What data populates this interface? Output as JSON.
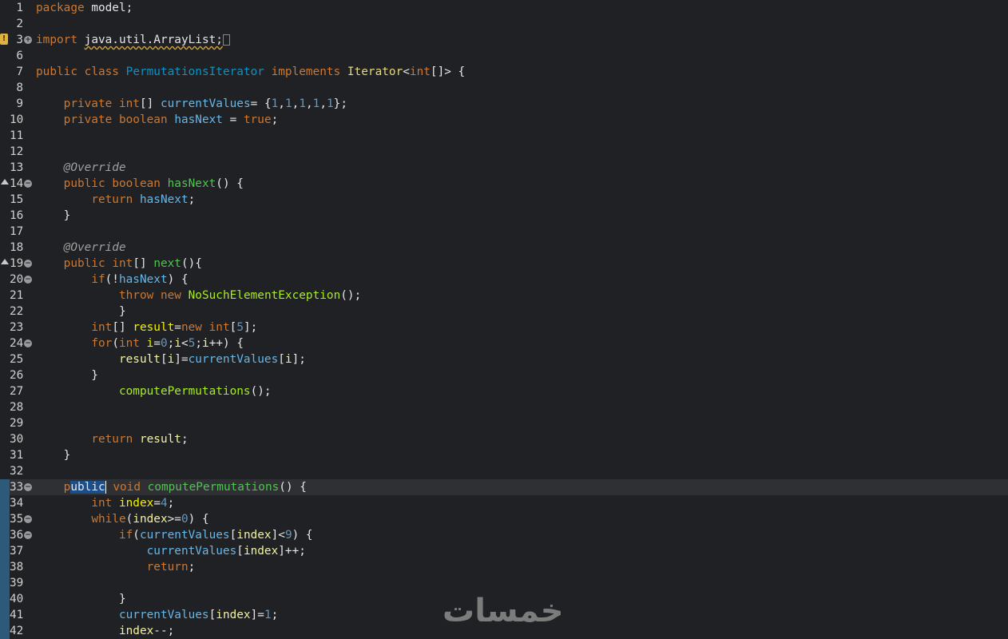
{
  "editor": {
    "language": "Java",
    "lines": [
      {
        "n": "1",
        "tokens": [
          [
            "kw",
            "package"
          ],
          [
            "plain",
            " model;"
          ]
        ]
      },
      {
        "n": "2",
        "tokens": []
      },
      {
        "n": "3",
        "fold": "+",
        "marker": "warn",
        "tokens": [
          [
            "kw",
            "import"
          ],
          [
            "plain",
            " "
          ],
          [
            "plain squig",
            "java.util.ArrayList;"
          ],
          [
            "box",
            ""
          ]
        ]
      },
      {
        "n": "6",
        "tokens": []
      },
      {
        "n": "7",
        "tokens": [
          [
            "kw",
            "public"
          ],
          [
            "plain",
            " "
          ],
          [
            "kw",
            "class"
          ],
          [
            "plain",
            " "
          ],
          [
            "cls",
            "PermutationsIterator"
          ],
          [
            "plain",
            " "
          ],
          [
            "kw",
            "implements"
          ],
          [
            "plain",
            " "
          ],
          [
            "iface",
            "Iterator"
          ],
          [
            "plain",
            "<"
          ],
          [
            "type",
            "int"
          ],
          [
            "plain",
            "[]> {"
          ]
        ]
      },
      {
        "n": "8",
        "tokens": []
      },
      {
        "n": "9",
        "tokens": [
          [
            "plain",
            "    "
          ],
          [
            "kw",
            "private"
          ],
          [
            "plain",
            " "
          ],
          [
            "type",
            "int"
          ],
          [
            "plain",
            "[] "
          ],
          [
            "fld",
            "currentValues"
          ],
          [
            "plain",
            "= {"
          ],
          [
            "num",
            "1"
          ],
          [
            "plain",
            ","
          ],
          [
            "num",
            "1"
          ],
          [
            "plain",
            ","
          ],
          [
            "num",
            "1"
          ],
          [
            "plain",
            ","
          ],
          [
            "num",
            "1"
          ],
          [
            "plain",
            ","
          ],
          [
            "num",
            "1"
          ],
          [
            "plain",
            "};"
          ]
        ]
      },
      {
        "n": "10",
        "tokens": [
          [
            "plain",
            "    "
          ],
          [
            "kw",
            "private"
          ],
          [
            "plain",
            " "
          ],
          [
            "type",
            "boolean"
          ],
          [
            "plain",
            " "
          ],
          [
            "fld",
            "hasNext"
          ],
          [
            "plain",
            " = "
          ],
          [
            "kw",
            "true"
          ],
          [
            "plain",
            ";"
          ]
        ]
      },
      {
        "n": "11",
        "tokens": []
      },
      {
        "n": "12",
        "tokens": []
      },
      {
        "n": "13",
        "tokens": [
          [
            "plain",
            "    "
          ],
          [
            "ann",
            "@Override"
          ]
        ]
      },
      {
        "n": "14",
        "fold": "-",
        "marker": "override",
        "tokens": [
          [
            "plain",
            "    "
          ],
          [
            "kw",
            "public"
          ],
          [
            "plain",
            " "
          ],
          [
            "type",
            "boolean"
          ],
          [
            "plain",
            " "
          ],
          [
            "meth",
            "hasNext"
          ],
          [
            "plain",
            "() {"
          ]
        ]
      },
      {
        "n": "15",
        "tokens": [
          [
            "plain",
            "        "
          ],
          [
            "kw",
            "return"
          ],
          [
            "plain",
            " "
          ],
          [
            "fld",
            "hasNext"
          ],
          [
            "plain",
            ";"
          ]
        ]
      },
      {
        "n": "16",
        "tokens": [
          [
            "plain",
            "    }"
          ]
        ]
      },
      {
        "n": "17",
        "tokens": []
      },
      {
        "n": "18",
        "tokens": [
          [
            "plain",
            "    "
          ],
          [
            "ann",
            "@Override"
          ]
        ]
      },
      {
        "n": "19",
        "fold": "-",
        "marker": "override",
        "tokens": [
          [
            "plain",
            "    "
          ],
          [
            "kw",
            "public"
          ],
          [
            "plain",
            " "
          ],
          [
            "type",
            "int"
          ],
          [
            "plain",
            "[] "
          ],
          [
            "meth",
            "next"
          ],
          [
            "plain",
            "(){"
          ]
        ]
      },
      {
        "n": "20",
        "fold": "-",
        "tokens": [
          [
            "plain",
            "        "
          ],
          [
            "kw",
            "if"
          ],
          [
            "plain",
            "(!"
          ],
          [
            "fld",
            "hasNext"
          ],
          [
            "plain",
            ") {"
          ]
        ]
      },
      {
        "n": "21",
        "tokens": [
          [
            "plain",
            "            "
          ],
          [
            "kw",
            "throw"
          ],
          [
            "plain",
            " "
          ],
          [
            "kw",
            "new"
          ],
          [
            "plain",
            " "
          ],
          [
            "exc",
            "NoSuchElementException"
          ],
          [
            "plain",
            "();"
          ]
        ]
      },
      {
        "n": "22",
        "tokens": [
          [
            "plain",
            "            }"
          ]
        ]
      },
      {
        "n": "23",
        "tokens": [
          [
            "plain",
            "        "
          ],
          [
            "type",
            "int"
          ],
          [
            "plain",
            "[] "
          ],
          [
            "loc",
            "result"
          ],
          [
            "plain",
            "="
          ],
          [
            "kw",
            "new"
          ],
          [
            "plain",
            " "
          ],
          [
            "type",
            "int"
          ],
          [
            "plain",
            "["
          ],
          [
            "num",
            "5"
          ],
          [
            "plain",
            "];"
          ]
        ]
      },
      {
        "n": "24",
        "fold": "-",
        "tokens": [
          [
            "plain",
            "        "
          ],
          [
            "kw",
            "for"
          ],
          [
            "plain",
            "("
          ],
          [
            "type",
            "int"
          ],
          [
            "plain",
            " "
          ],
          [
            "loc",
            "i"
          ],
          [
            "plain",
            "="
          ],
          [
            "num",
            "0"
          ],
          [
            "plain",
            ";"
          ],
          [
            "locv",
            "i"
          ],
          [
            "plain",
            "<"
          ],
          [
            "num",
            "5"
          ],
          [
            "plain",
            ";"
          ],
          [
            "locv",
            "i"
          ],
          [
            "plain",
            "++) {"
          ]
        ]
      },
      {
        "n": "25",
        "tokens": [
          [
            "plain",
            "            "
          ],
          [
            "locv",
            "result"
          ],
          [
            "plain",
            "["
          ],
          [
            "locv",
            "i"
          ],
          [
            "plain",
            "]="
          ],
          [
            "fld",
            "currentValues"
          ],
          [
            "plain",
            "["
          ],
          [
            "locv",
            "i"
          ],
          [
            "plain",
            "];"
          ]
        ]
      },
      {
        "n": "26",
        "tokens": [
          [
            "plain",
            "        }"
          ]
        ]
      },
      {
        "n": "27",
        "tokens": [
          [
            "plain",
            "            "
          ],
          [
            "mcall",
            "computePermutations"
          ],
          [
            "plain",
            "();"
          ]
        ]
      },
      {
        "n": "28",
        "tokens": []
      },
      {
        "n": "29",
        "tokens": []
      },
      {
        "n": "30",
        "tokens": [
          [
            "plain",
            "        "
          ],
          [
            "kw",
            "return"
          ],
          [
            "plain",
            " "
          ],
          [
            "locv",
            "result"
          ],
          [
            "plain",
            ";"
          ]
        ]
      },
      {
        "n": "31",
        "tokens": [
          [
            "plain",
            "    }"
          ]
        ]
      },
      {
        "n": "32",
        "tokens": []
      },
      {
        "n": "33",
        "fold": "-",
        "current": true,
        "occ": true,
        "tokens": [
          [
            "plain",
            "    "
          ],
          [
            "kw",
            "p"
          ],
          [
            "sel",
            "ublic"
          ],
          [
            "caret",
            ""
          ],
          [
            "plain",
            " "
          ],
          [
            "type",
            "void"
          ],
          [
            "plain",
            " "
          ],
          [
            "meth",
            "computePermutations"
          ],
          [
            "plain",
            "() {"
          ]
        ]
      },
      {
        "n": "34",
        "occ": true,
        "tokens": [
          [
            "plain",
            "        "
          ],
          [
            "type",
            "int"
          ],
          [
            "plain",
            " "
          ],
          [
            "loc",
            "index"
          ],
          [
            "plain",
            "="
          ],
          [
            "num",
            "4"
          ],
          [
            "plain",
            ";"
          ]
        ]
      },
      {
        "n": "35",
        "fold": "-",
        "occ": true,
        "tokens": [
          [
            "plain",
            "        "
          ],
          [
            "kw",
            "while"
          ],
          [
            "plain",
            "("
          ],
          [
            "locv",
            "index"
          ],
          [
            "plain",
            ">="
          ],
          [
            "num",
            "0"
          ],
          [
            "plain",
            ") {"
          ]
        ]
      },
      {
        "n": "36",
        "fold": "-",
        "occ": true,
        "tokens": [
          [
            "plain",
            "            "
          ],
          [
            "kw",
            "if"
          ],
          [
            "plain",
            "("
          ],
          [
            "fld",
            "currentValues"
          ],
          [
            "plain",
            "["
          ],
          [
            "locv",
            "index"
          ],
          [
            "plain",
            "]<"
          ],
          [
            "num",
            "9"
          ],
          [
            "plain",
            ") {"
          ]
        ]
      },
      {
        "n": "37",
        "occ": true,
        "tokens": [
          [
            "plain",
            "                "
          ],
          [
            "fld",
            "currentValues"
          ],
          [
            "plain",
            "["
          ],
          [
            "locv",
            "index"
          ],
          [
            "plain",
            "]++;"
          ]
        ]
      },
      {
        "n": "38",
        "occ": true,
        "tokens": [
          [
            "plain",
            "                "
          ],
          [
            "kw",
            "return"
          ],
          [
            "plain",
            ";"
          ]
        ]
      },
      {
        "n": "39",
        "occ": true,
        "tokens": []
      },
      {
        "n": "40",
        "occ": true,
        "tokens": [
          [
            "plain",
            "            }"
          ]
        ]
      },
      {
        "n": "41",
        "occ": true,
        "tokens": [
          [
            "plain",
            "            "
          ],
          [
            "fld",
            "currentValues"
          ],
          [
            "plain",
            "["
          ],
          [
            "locv",
            "index"
          ],
          [
            "plain",
            "]="
          ],
          [
            "num",
            "1"
          ],
          [
            "plain",
            ";"
          ]
        ]
      },
      {
        "n": "42",
        "occ": true,
        "tokens": [
          [
            "plain",
            "            "
          ],
          [
            "locv",
            "index"
          ],
          [
            "plain",
            "--;"
          ]
        ]
      }
    ]
  },
  "watermark": {
    "text": "خمسات"
  }
}
